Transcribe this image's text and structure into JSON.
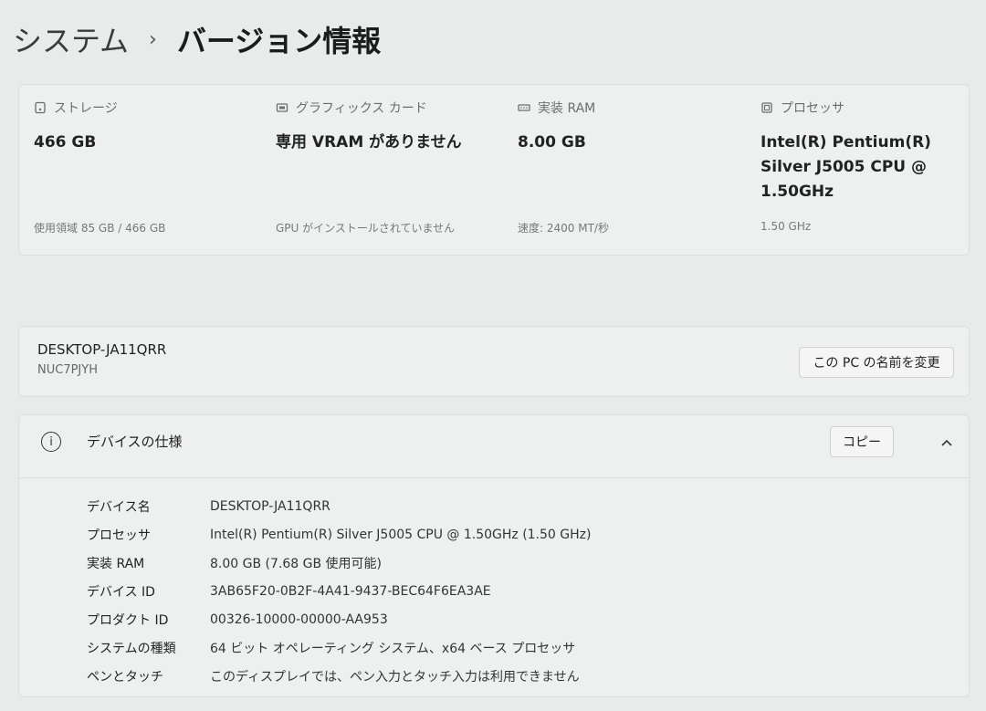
{
  "breadcrumb": {
    "parent": "システム",
    "separator": "›",
    "current": "バージョン情報"
  },
  "specs_top": [
    {
      "icon": "storage-icon",
      "label": "ストレージ",
      "value": "466 GB",
      "sub": "使用領域 85 GB / 466 GB"
    },
    {
      "icon": "graphics-card-icon",
      "label": "グラフィックス カード",
      "value": "専用 VRAM がありません",
      "sub": "GPU がインストールされていません"
    },
    {
      "icon": "ram-icon",
      "label": "実装 RAM",
      "value": "8.00 GB",
      "sub": "速度: 2400 MT/秒"
    },
    {
      "icon": "processor-icon",
      "label": "プロセッサ",
      "value": "Intel(R) Pentium(R) Silver J5005 CPU @ 1.50GHz",
      "sub": "1.50 GHz"
    }
  ],
  "device": {
    "name": "DESKTOP-JA11QRR",
    "model": "NUC7PJYH",
    "rename_label": "この PC の名前を変更"
  },
  "device_specs": {
    "title": "デバイスの仕様",
    "copy_label": "コピー",
    "rows": [
      {
        "key": "デバイス名",
        "value": "DESKTOP-JA11QRR"
      },
      {
        "key": "プロセッサ",
        "value": "Intel(R) Pentium(R) Silver J5005 CPU @ 1.50GHz (1.50 GHz)"
      },
      {
        "key": "実装 RAM",
        "value": "8.00 GB (7.68 GB 使用可能)"
      },
      {
        "key": "デバイス ID",
        "value": "3AB65F20-0B2F-4A41-9437-BEC64F6EA3AE"
      },
      {
        "key": "プロダクト ID",
        "value": "00326-10000-00000-AA953"
      },
      {
        "key": "システムの種類",
        "value": "64 ビット オペレーティング システム、x64 ベース プロセッサ"
      },
      {
        "key": "ペンとタッチ",
        "value": "このディスプレイでは、ペン入力とタッチ入力は利用できません"
      }
    ]
  }
}
